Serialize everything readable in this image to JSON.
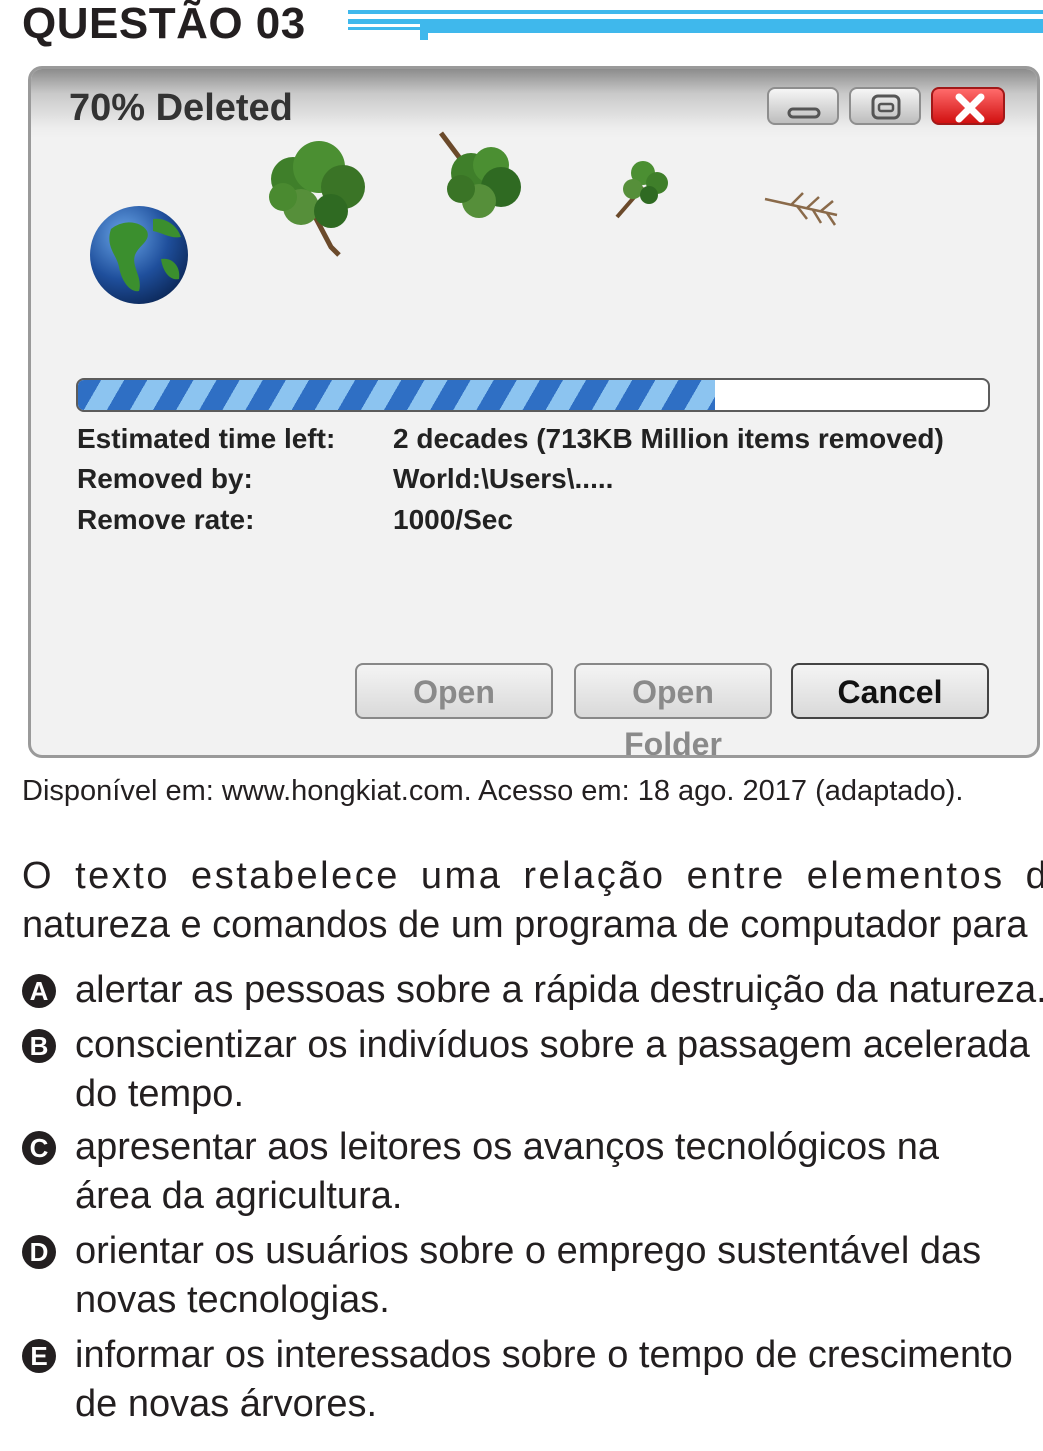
{
  "question": {
    "title": "QUESTÃO 03"
  },
  "dialog": {
    "title": "70% Deleted",
    "progress_fraction": 0.7,
    "rows": [
      {
        "label": "Estimated time left:",
        "value": "2 decades (713KB Million items removed)"
      },
      {
        "label": "Removed by:",
        "value": "World:\\Users\\....."
      },
      {
        "label": "Remove rate:",
        "value": "1000/Sec"
      }
    ],
    "buttons": {
      "open": "Open",
      "open_folder": "Open Folder",
      "cancel": "Cancel"
    },
    "icons": [
      "globe-icon",
      "tree-icon",
      "minimize-icon",
      "restore-icon",
      "close-icon"
    ]
  },
  "source": "Disponível em: www.hongkiat.com. Acesso em: 18 ago. 2017 (adaptado).",
  "stem": {
    "line1": "O texto estabelece uma relação entre elementos da",
    "line2": "natureza e comandos de um programa de computador para"
  },
  "options": [
    {
      "letter": "A",
      "line1": "alertar as pessoas sobre a rápida destruição da natureza.",
      "line2": ""
    },
    {
      "letter": "B",
      "line1": "conscientizar os indivíduos sobre a passagem acelerada",
      "line2": "do tempo."
    },
    {
      "letter": "C",
      "line1": "apresentar aos leitores os avanços tecnológicos na",
      "line2": "área da agricultura."
    },
    {
      "letter": "D",
      "line1": "orientar os usuários sobre o emprego sustentável das",
      "line2": "novas tecnologias."
    },
    {
      "letter": "E",
      "line1": "informar os interessados sobre o tempo de crescimento",
      "line2": "de novas árvores."
    }
  ],
  "colors": {
    "accent_blue": "#3fb8ec",
    "progress_blue": "#2f6fc4",
    "close_red": "#e01b1b"
  }
}
